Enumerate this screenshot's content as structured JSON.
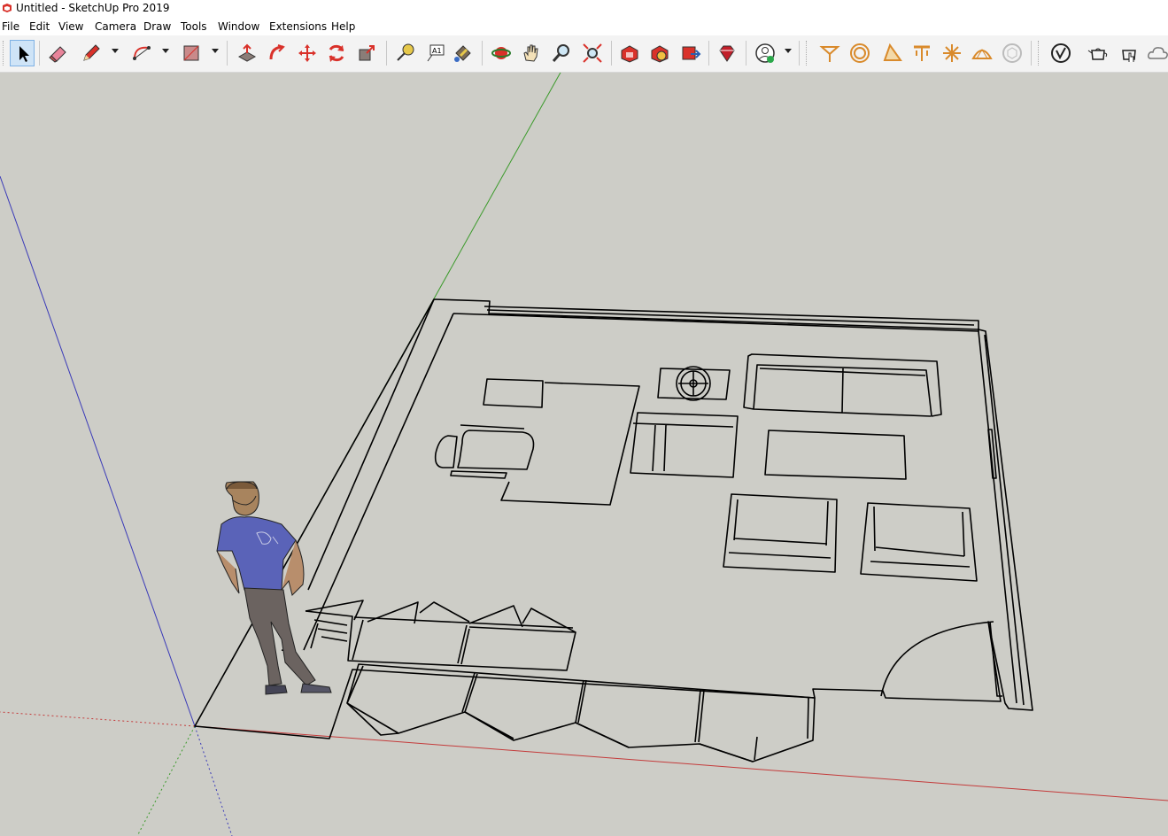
{
  "window": {
    "title": "Untitled - SketchUp Pro 2019"
  },
  "menu": {
    "file": "File",
    "edit": "Edit",
    "view": "View",
    "camera": "Camera",
    "draw": "Draw",
    "tools": "Tools",
    "window": "Window",
    "extensions": "Extensions",
    "help": "Help"
  },
  "toolbar": {
    "tools": [
      "select-icon",
      "eraser-icon",
      "pencil-icon",
      "arc-icon",
      "rectangle-icon",
      "push-pull-icon",
      "follow-me-icon",
      "move-icon",
      "rotate-icon",
      "scale-icon",
      "tape-measure-icon",
      "text-icon",
      "paint-bucket-icon",
      "orbit-icon",
      "pan-icon",
      "zoom-icon",
      "zoom-extents-icon",
      "warehouse-icon",
      "components-icon",
      "send-to-layout-icon",
      "extension-warehouse-icon",
      "account-icon",
      "sandbox-icons",
      "styles-icons",
      "cloud-icon"
    ]
  },
  "colors": {
    "sketchup_red": "#d9312a",
    "toolbar_bg": "#f3f3f3",
    "viewport_bg": "#cdcdc7",
    "axis_red": "#c43b3b",
    "axis_green": "#3a9a2a",
    "axis_blue": "#3a3ab8",
    "sandbox_orange": "#d98a2b",
    "person_shirt": "#5a63b8",
    "person_pants": "#6b6360"
  }
}
